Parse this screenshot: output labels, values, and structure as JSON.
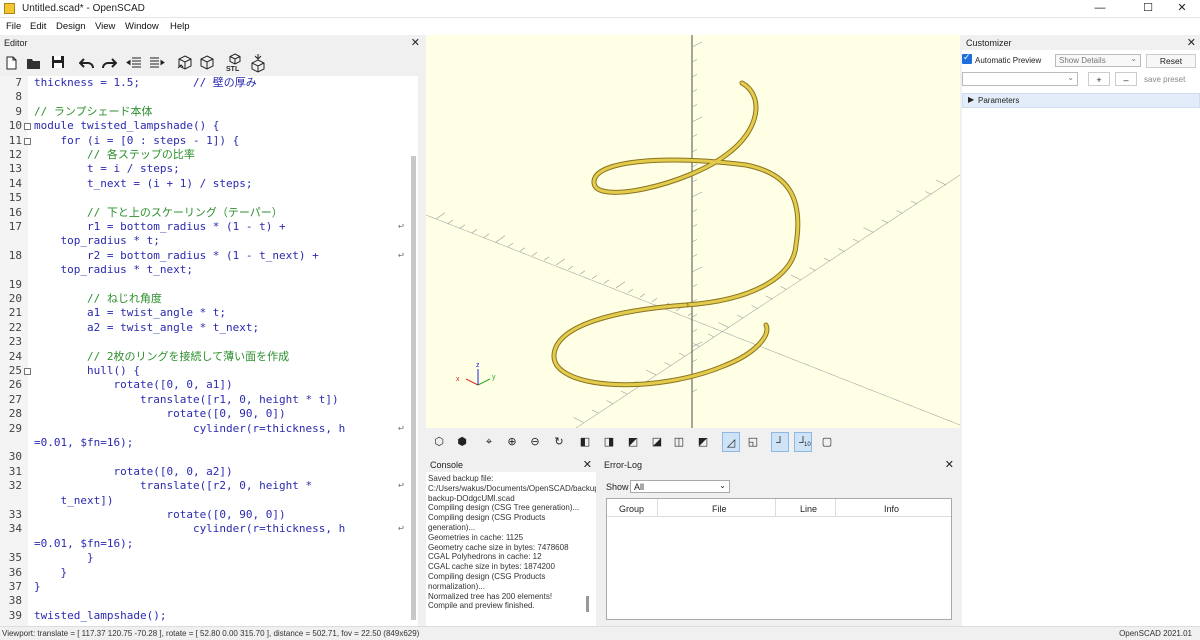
{
  "window": {
    "title": "Untitled.scad* - OpenSCAD",
    "controls": [
      "—",
      "☐",
      "✕"
    ]
  },
  "menu": [
    "File",
    "Edit",
    "Design",
    "View",
    "Window",
    "Help"
  ],
  "editor": {
    "title": "Editor",
    "close": "✕",
    "toolbar": [
      "new-file",
      "open-file",
      "save-file",
      "undo",
      "redo",
      "unindent",
      "indent",
      "preview",
      "render",
      "export-stl",
      "send-to-print"
    ],
    "stl_label": "STL",
    "lines": [
      {
        "n": "7",
        "text": "thickness = 1.5;        // 壁の厚み",
        "type": "code"
      },
      {
        "n": "8",
        "text": "",
        "type": "code"
      },
      {
        "n": "9",
        "text": "// ランプシェード本体",
        "type": "cmt"
      },
      {
        "n": "10",
        "text": "module twisted_lampshade() {",
        "type": "code",
        "fold": true
      },
      {
        "n": "11",
        "text": "    for (i = [0 : steps - 1]) {",
        "type": "code",
        "fold": true
      },
      {
        "n": "12",
        "text": "        // 各ステップの比率",
        "type": "cmt"
      },
      {
        "n": "13",
        "text": "        t = i / steps;",
        "type": "code"
      },
      {
        "n": "14",
        "text": "        t_next = (i + 1) / steps;",
        "type": "code"
      },
      {
        "n": "15",
        "text": "",
        "type": "code"
      },
      {
        "n": "16",
        "text": "        // 下と上のスケーリング（テーパー）",
        "type": "cmt"
      },
      {
        "n": "17",
        "text": "        r1 = bottom_radius * (1 - t) +",
        "type": "code",
        "wrap": true
      },
      {
        "n": "",
        "text": "    top_radius * t;",
        "type": "code"
      },
      {
        "n": "18",
        "text": "        r2 = bottom_radius * (1 - t_next) +",
        "type": "code",
        "wrap": true
      },
      {
        "n": "",
        "text": "    top_radius * t_next;",
        "type": "code"
      },
      {
        "n": "19",
        "text": "",
        "type": "code"
      },
      {
        "n": "20",
        "text": "        // ねじれ角度",
        "type": "cmt"
      },
      {
        "n": "21",
        "text": "        a1 = twist_angle * t;",
        "type": "code"
      },
      {
        "n": "22",
        "text": "        a2 = twist_angle * t_next;",
        "type": "code"
      },
      {
        "n": "23",
        "text": "",
        "type": "code"
      },
      {
        "n": "24",
        "text": "        // 2枚のリングを接続して薄い面を作成",
        "type": "cmt"
      },
      {
        "n": "25",
        "text": "        hull() {",
        "type": "code",
        "fold": true
      },
      {
        "n": "26",
        "text": "            rotate([0, 0, a1])",
        "type": "code"
      },
      {
        "n": "27",
        "text": "                translate([r1, 0, height * t])",
        "type": "code"
      },
      {
        "n": "28",
        "text": "                    rotate([0, 90, 0])",
        "type": "code"
      },
      {
        "n": "29",
        "text": "                        cylinder(r=thickness, h",
        "type": "code",
        "wrap": true
      },
      {
        "n": "",
        "text": "=0.01, $fn=16);",
        "type": "code"
      },
      {
        "n": "30",
        "text": "",
        "type": "code"
      },
      {
        "n": "31",
        "text": "            rotate([0, 0, a2])",
        "type": "code"
      },
      {
        "n": "32",
        "text": "                translate([r2, 0, height *",
        "type": "code",
        "wrap": true
      },
      {
        "n": "",
        "text": "    t_next])",
        "type": "code"
      },
      {
        "n": "33",
        "text": "                    rotate([0, 90, 0])",
        "type": "code"
      },
      {
        "n": "34",
        "text": "                        cylinder(r=thickness, h",
        "type": "code",
        "wrap": true
      },
      {
        "n": "",
        "text": "=0.01, $fn=16);",
        "type": "code"
      },
      {
        "n": "35",
        "text": "        }",
        "type": "code"
      },
      {
        "n": "36",
        "text": "    }",
        "type": "code"
      },
      {
        "n": "37",
        "text": "}",
        "type": "code"
      },
      {
        "n": "38",
        "text": "",
        "type": "code"
      },
      {
        "n": "39",
        "text": "twisted_lampshade();",
        "type": "code"
      }
    ]
  },
  "view_toolbar": [
    "preview",
    "render",
    "view-all",
    "zoom-in",
    "zoom-out",
    "reset-view",
    "right",
    "top",
    "bottom",
    "left",
    "front",
    "back",
    "perspective",
    "orthogonal",
    "show-axes",
    "show-scale",
    "show-edges"
  ],
  "scale_marker": "10",
  "console": {
    "title": "Console",
    "close": "✕",
    "text": "Saved backup file: C:/Users/wakus/Documents/OpenSCAD/backups/unsaved-backup-DOdgcUMl.scad\nCompiling design (CSG Tree generation)...\nCompiling design (CSG Products generation)...\nGeometries in cache: 1125\nGeometry cache size in bytes: 7478608\nCGAL Polyhedrons in cache: 12\nCGAL cache size in bytes: 1874200\nCompiling design (CSG Products normalization)...\nNormalized tree has 200 elements!\nCompile and preview finished."
  },
  "error_log": {
    "title": "Error-Log",
    "close": "✕",
    "show_label": "Show",
    "show_value": "All",
    "columns": [
      "Group",
      "File",
      "Line",
      "Info"
    ]
  },
  "customizer": {
    "title": "Customizer",
    "close": "✕",
    "auto_preview": "Automatic Preview",
    "show_details": "Show Details",
    "reset": "Reset",
    "plus": "+",
    "minus": "–",
    "save_preset": "save preset",
    "parameters": "Parameters"
  },
  "status": {
    "viewport": "Viewport: translate = [ 117.37 120.75 -70.28 ], rotate = [ 52.80 0.00 315.70 ], distance = 502.71, fov = 22.50 (849x629)",
    "version": "OpenSCAD 2021.01"
  },
  "colors": {
    "viewport_bg": "#ffffe5",
    "model": "#d7bd3f",
    "accent": "#1e6fd9"
  }
}
